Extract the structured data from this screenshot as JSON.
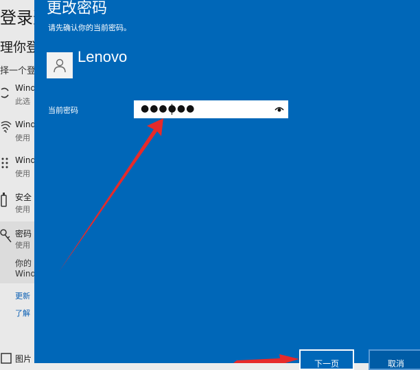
{
  "background": {
    "title": "登录选",
    "subtitle": "理你登",
    "line": "择一个登录",
    "items": [
      {
        "title": "Wind",
        "desc": "此选"
      },
      {
        "title": "Wind",
        "desc": "使用"
      },
      {
        "title": "Wind",
        "desc": "使用"
      },
      {
        "title": "安全",
        "desc": "使用"
      },
      {
        "title": "密码",
        "desc": "使用"
      }
    ],
    "note1": "你的",
    "note2": "Wind",
    "link1": "更新",
    "link2": "了解",
    "bottom_item": "图片"
  },
  "dialog": {
    "title": "更改密码",
    "subtitle": "请先确认你的当前密码。",
    "username": "Lenovo",
    "password_label": "当前密码",
    "password_value": "●●●●●●",
    "next_button": "下一页",
    "cancel_button": "取消"
  },
  "colors": {
    "dialog_bg": "#0067b8",
    "annotation_arrow": "#e62a2a"
  }
}
